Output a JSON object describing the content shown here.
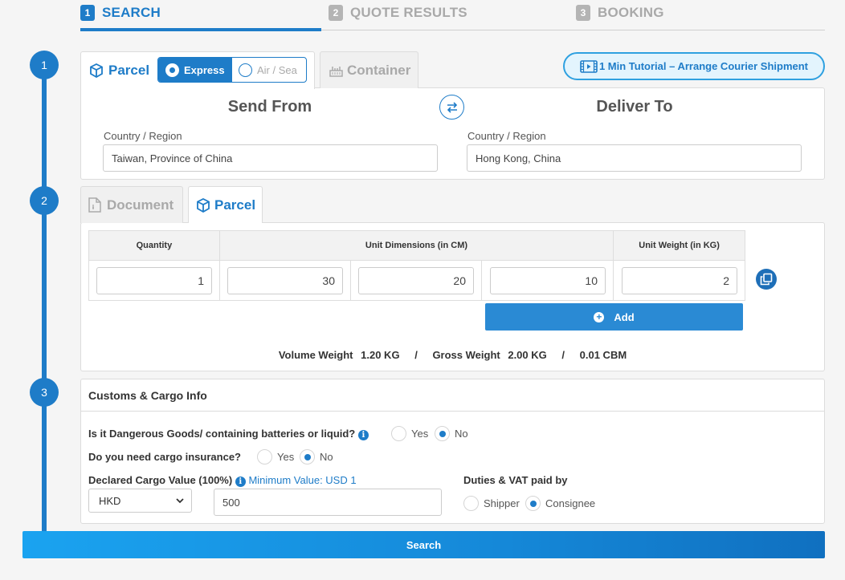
{
  "steps": [
    {
      "num": "1",
      "label": "SEARCH"
    },
    {
      "num": "2",
      "label": "QUOTE RESULTS"
    },
    {
      "num": "3",
      "label": "BOOKING"
    }
  ],
  "sections": [
    "1",
    "2",
    "3"
  ],
  "shipment_tabs": {
    "parcel": "Parcel",
    "container": "Container"
  },
  "mode_toggle": {
    "express": "Express",
    "air_sea": "Air / Sea",
    "selected": "Express"
  },
  "tutorial": {
    "label": "1 Min Tutorial – Arrange Courier Shipment"
  },
  "route": {
    "send_from_title": "Send From",
    "deliver_to_title": "Deliver To",
    "from_label": "Country / Region",
    "from_value": "Taiwan, Province of China",
    "to_label": "Country / Region",
    "to_value": "Hong Kong, China"
  },
  "item_tabs": {
    "document": "Document",
    "parcel": "Parcel",
    "selected": "Parcel"
  },
  "dimensions": {
    "headers": {
      "quantity": "Quantity",
      "unit_dimensions": "Unit Dimensions (in CM)",
      "unit_weight": "Unit Weight (in KG)"
    },
    "quantity": "1",
    "length": "30",
    "width": "20",
    "height": "10",
    "weight": "2",
    "add_label": "Add"
  },
  "summary": {
    "volume_weight_label": "Volume Weight",
    "volume_weight_value": "1.20 KG",
    "sep": "/",
    "gross_weight_label": "Gross Weight",
    "gross_weight_value": "2.00 KG",
    "cbm": "0.01 CBM"
  },
  "customs": {
    "title": "Customs & Cargo Info",
    "dangerous_q": "Is it Dangerous Goods/ containing batteries or liquid?",
    "dangerous_yes": "Yes",
    "dangerous_no": "No",
    "dangerous_selected": "No",
    "insurance_q": "Do you need cargo insurance?",
    "insurance_yes": "Yes",
    "insurance_no": "No",
    "insurance_selected": "No",
    "declared_label": "Declared Cargo Value (100%)",
    "min_value": "Minimum Value: USD 1",
    "currency": "HKD",
    "declared_value": "500",
    "duties_label": "Duties & VAT paid by",
    "duties_shipper": "Shipper",
    "duties_consignee": "Consignee",
    "duties_selected": "Consignee"
  },
  "search_button": "Search",
  "colors": {
    "primary": "#1e7cc8",
    "inactive": "#a9a9a9"
  }
}
